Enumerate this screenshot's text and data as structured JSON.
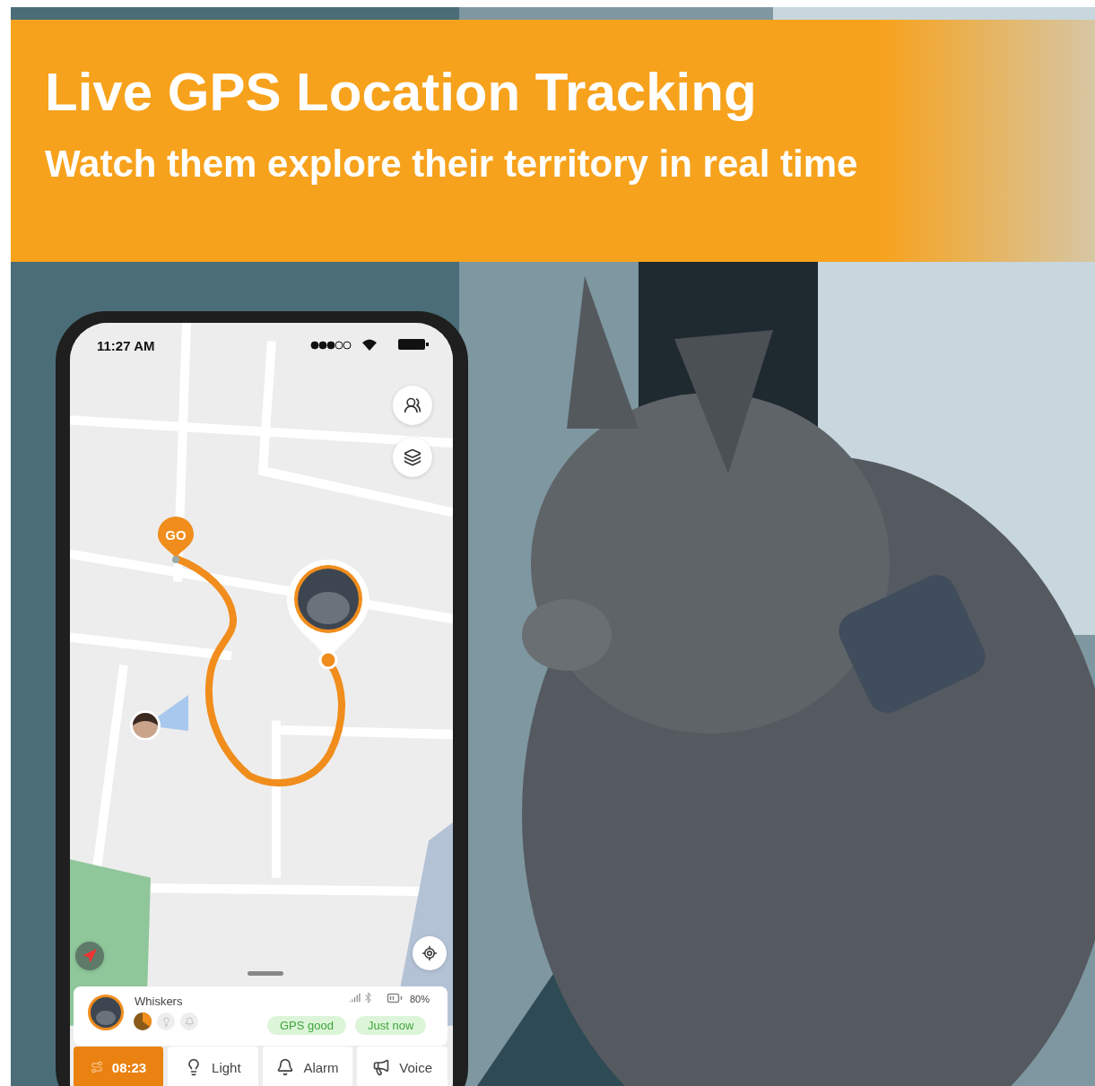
{
  "banner": {
    "title": "Live GPS Location Tracking",
    "subtitle": "Watch them explore their territory in real time"
  },
  "phone": {
    "status_bar": {
      "time": "11:27 AM"
    },
    "map": {
      "start_marker": "GO"
    },
    "pet_card": {
      "name": "Whiskers",
      "battery": "80%",
      "badges": [
        "GPS good",
        "Just now"
      ]
    },
    "actions": [
      {
        "kind": "timer",
        "label": "08:23",
        "selected": true
      },
      {
        "kind": "light",
        "label": "Light",
        "selected": false
      },
      {
        "kind": "alarm",
        "label": "Alarm",
        "selected": false
      },
      {
        "kind": "voice",
        "label": "Voice",
        "selected": false
      }
    ]
  }
}
